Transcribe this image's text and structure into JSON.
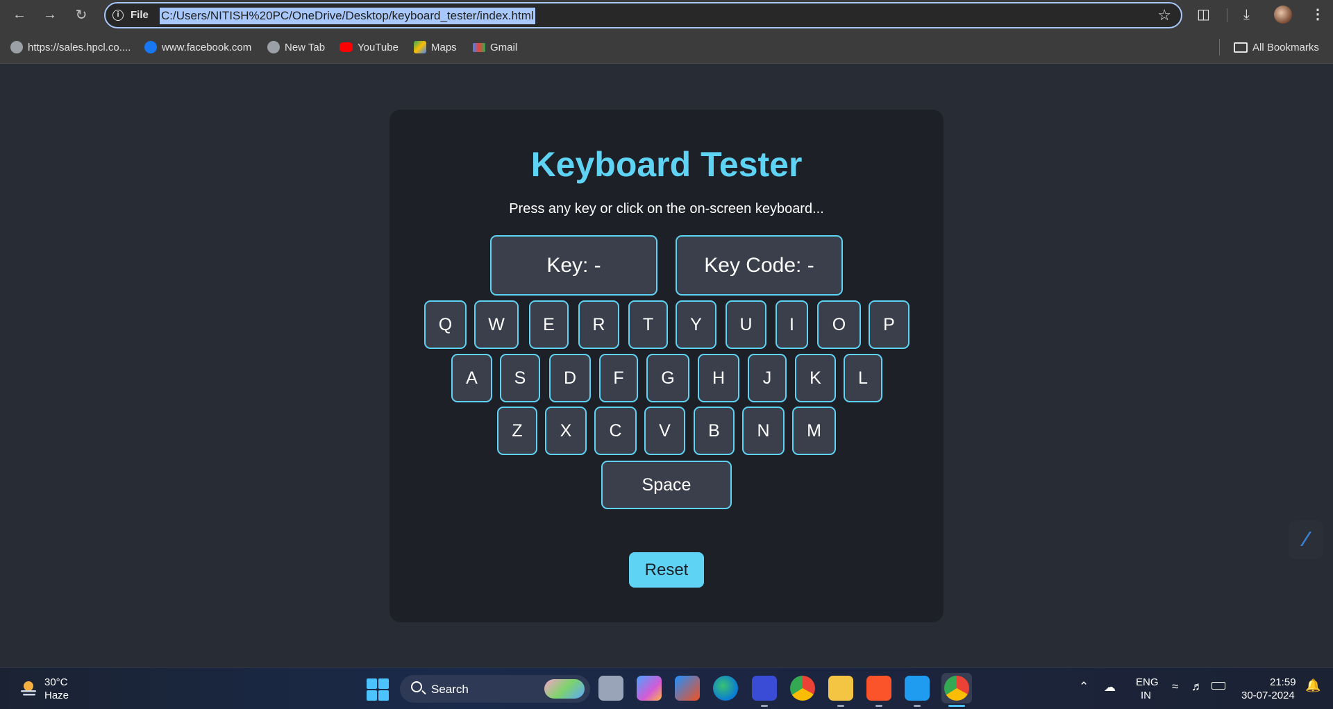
{
  "browser": {
    "url_scheme": "File",
    "url": "C:/Users/NITISH%20PC/OneDrive/Desktop/keyboard_tester/index.html",
    "bookmarks": [
      {
        "label": "https://sales.hpcl.co...."
      },
      {
        "label": "www.facebook.com"
      },
      {
        "label": "New Tab"
      },
      {
        "label": "YouTube"
      },
      {
        "label": "Maps"
      },
      {
        "label": "Gmail"
      }
    ],
    "all_bookmarks_label": "All Bookmarks"
  },
  "app": {
    "title": "Keyboard Tester",
    "subtitle": "Press any key or click on the on-screen keyboard...",
    "key_readout": "Key: -",
    "keycode_readout": "Key Code: -",
    "rows": [
      [
        "Q",
        "W",
        "E",
        "R",
        "T",
        "Y",
        "U",
        "I",
        "O",
        "P"
      ],
      [
        "A",
        "S",
        "D",
        "F",
        "G",
        "H",
        "J",
        "K",
        "L"
      ],
      [
        "Z",
        "X",
        "C",
        "V",
        "B",
        "N",
        "M"
      ]
    ],
    "space_label": "Space",
    "reset_label": "Reset"
  },
  "taskbar": {
    "temperature": "30°C",
    "weather": "Haze",
    "search_label": "Search",
    "language_line1": "ENG",
    "language_line2": "IN",
    "time": "21:59",
    "date": "30-07-2024"
  },
  "colors": {
    "accent": "#5fd3f3",
    "card_background": "#1d2027",
    "page_background": "#282c34",
    "key_background": "#3a3f4b"
  }
}
